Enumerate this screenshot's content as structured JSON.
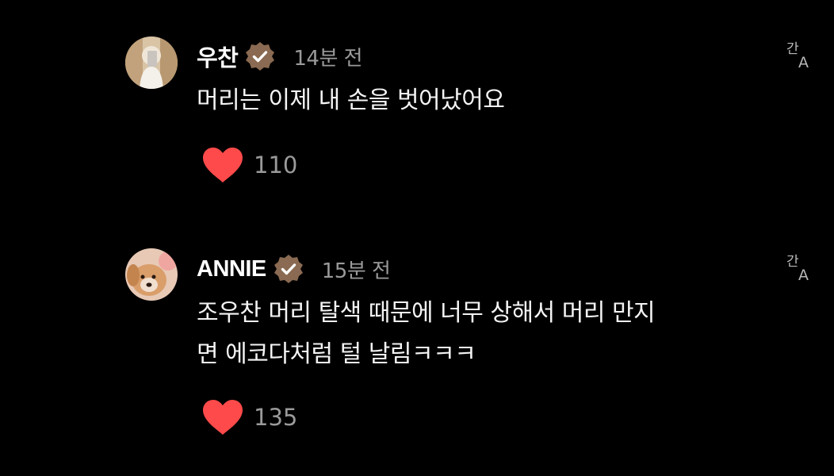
{
  "colors": {
    "background": "#000000",
    "verified_badge": "#8a6a52",
    "heart": "#fe4a4a",
    "timestamp": "#9a9a9a"
  },
  "comments": [
    {
      "username": "우찬",
      "verified": true,
      "timestamp": "14분 전",
      "text": "머리는 이제 내 손을 벗어났어요",
      "likes": "110",
      "avatar_icon": "person-photo-avatar",
      "translate_icon": "translate-icon"
    },
    {
      "username": "ANNIE",
      "verified": true,
      "timestamp": "15분 전",
      "text_lines": [
        "조우찬 머리 탈색 때문에 너무 상해서 머리 만지",
        "면 에코다처럼 털 날림ㅋㅋㅋ"
      ],
      "likes": "135",
      "avatar_icon": "dog-photo-avatar",
      "translate_icon": "translate-icon"
    }
  ]
}
